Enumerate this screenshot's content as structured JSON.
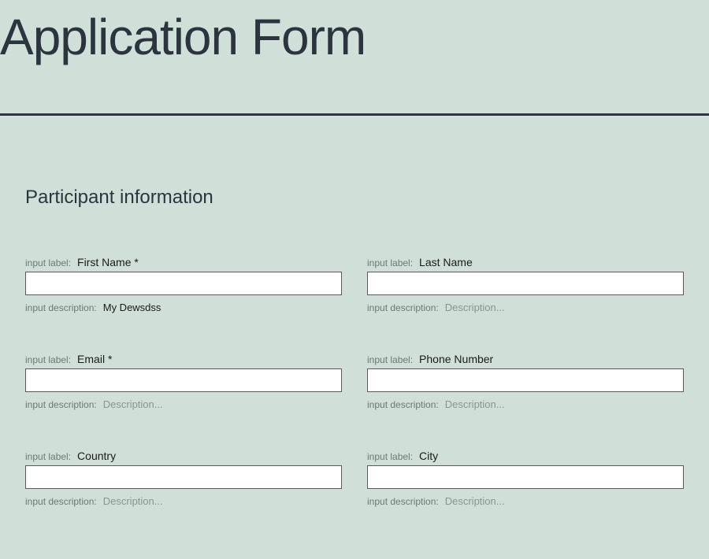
{
  "page": {
    "title": "Application Form"
  },
  "section": {
    "title": "Participant information"
  },
  "meta": {
    "input_label_prefix": "input label:",
    "input_description_prefix": "input description:",
    "description_placeholder": "Description..."
  },
  "fields": {
    "first_name": {
      "label": "First Name *",
      "value": "",
      "description": "My Dewsdss"
    },
    "last_name": {
      "label": "Last Name",
      "value": "",
      "description": ""
    },
    "email": {
      "label": "Email *",
      "value": "",
      "description": ""
    },
    "phone": {
      "label": "Phone Number",
      "value": "",
      "description": ""
    },
    "country": {
      "label": "Country",
      "value": "",
      "description": ""
    },
    "city": {
      "label": "City",
      "value": "",
      "description": ""
    }
  }
}
